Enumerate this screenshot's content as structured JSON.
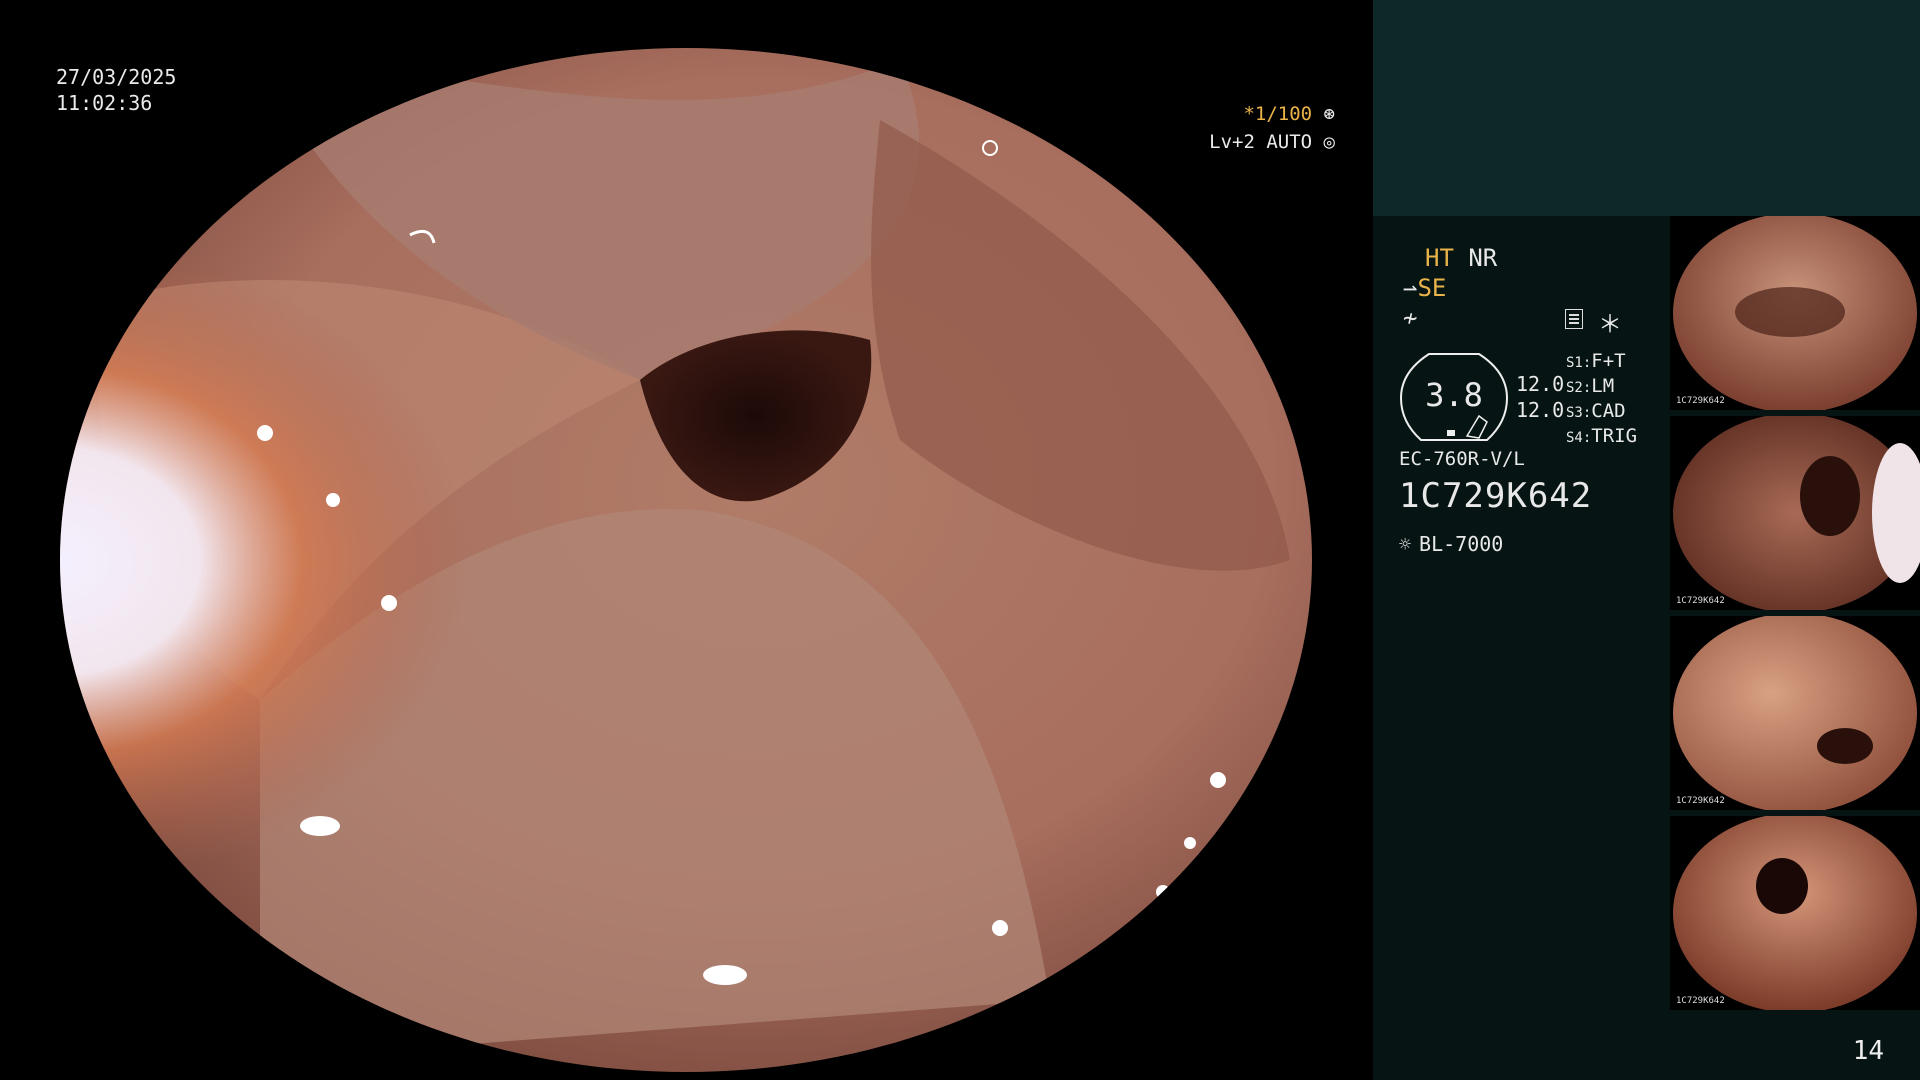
{
  "overlay": {
    "date": "27/03/2025",
    "time": "11:02:36",
    "shutter": "*1/100",
    "brightness": "Lv+2 AUTO"
  },
  "panel": {
    "mode_ht": "HT",
    "mode_nr": "NR",
    "mode_se": "SE",
    "gauge_value": "3.8",
    "gain_1": "12.0",
    "gain_2": "12.0",
    "switches": [
      {
        "key": "S1",
        "value": "F+T"
      },
      {
        "key": "S2",
        "value": "LM"
      },
      {
        "key": "S3",
        "value": "CAD"
      },
      {
        "key": "S4",
        "value": "TRIG"
      }
    ],
    "scope_model": "EC-760R-V/L",
    "serial": "1C729K642",
    "light_source": "BL-7000"
  },
  "thumbnails": [
    {
      "label": "1C729K642"
    },
    {
      "label": "1C729K642"
    },
    {
      "label": "1C729K642"
    },
    {
      "label": "1C729K642"
    }
  ],
  "page_number": "14",
  "colors": {
    "amber": "#e9b34a",
    "panel_bg": "#061514",
    "panel_top": "#0d2927"
  },
  "icons": [
    "shutter-icon",
    "brightness-icon",
    "structure-enhancement-icon",
    "filter-icon",
    "memory-icon",
    "asterisk-icon",
    "light-source-icon"
  ]
}
